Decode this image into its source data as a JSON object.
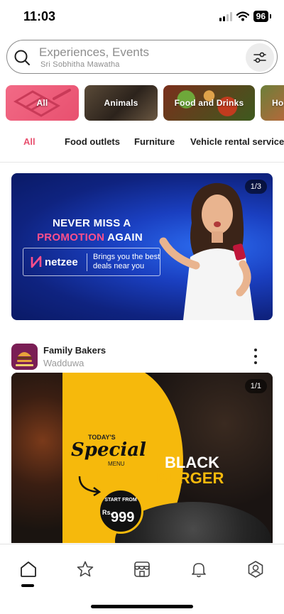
{
  "status": {
    "time": "11:03",
    "battery": "96"
  },
  "search": {
    "placeholder": "Experiences, Events",
    "location": "Sri Sobhitha Mawatha",
    "icon": "search-icon",
    "filter_icon": "sliders-icon"
  },
  "categories": [
    {
      "label": "All"
    },
    {
      "label": "Animals"
    },
    {
      "label": "Food and Drinks"
    },
    {
      "label": "Ho"
    }
  ],
  "tabs": [
    {
      "label": "All",
      "active": true
    },
    {
      "label": "Food outlets",
      "active": false
    },
    {
      "label": "Furniture",
      "active": false
    },
    {
      "label": "Vehicle rental service",
      "active": false
    }
  ],
  "promo": {
    "pager": "1/3",
    "line1": "NEVER MISS A",
    "line2_highlight": "PROMOTION",
    "line2_rest": "AGAIN",
    "brand": "netzee",
    "tagline": "Brings you the best deals near you"
  },
  "post": {
    "name": "Family Bakers",
    "location": "Wadduwa",
    "pager": "1/1",
    "image": {
      "todays": "TODAY'S",
      "special": "Special",
      "menu": "MENU",
      "black": "BLACK",
      "burger": "BURGER",
      "start_from": "START FROM",
      "currency": "Rs.",
      "price": "999"
    }
  },
  "nav": {
    "items": [
      "home-icon",
      "star-icon",
      "store-icon",
      "bell-icon",
      "profile-icon"
    ],
    "active": "home-icon"
  },
  "colors": {
    "accent": "#e8506f",
    "promo_pink": "#ff4f8b",
    "burger_yellow": "#f6b90c"
  }
}
